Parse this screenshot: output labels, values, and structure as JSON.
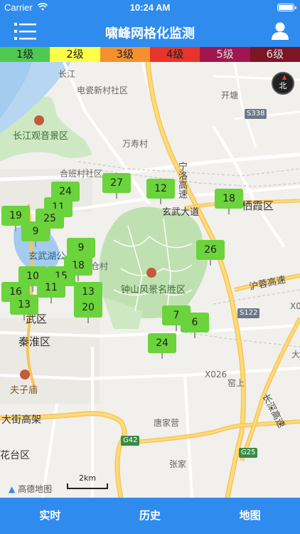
{
  "status_bar": {
    "carrier": "Carrier",
    "time": "10:24 AM"
  },
  "nav": {
    "title": "啸峰网格化监测"
  },
  "legend": [
    {
      "label": "1级",
      "color": "#4fc94f",
      "text_color": "#222222"
    },
    {
      "label": "2级",
      "color": "#ffff45",
      "text_color": "#222222"
    },
    {
      "label": "3级",
      "color": "#f5902f",
      "text_color": "#222222"
    },
    {
      "label": "4级",
      "color": "#e8342a",
      "text_color": "#222222"
    },
    {
      "label": "5级",
      "color": "#a0174f",
      "text_color": "#dddddd"
    },
    {
      "label": "6级",
      "color": "#7c1524",
      "text_color": "#dddddd"
    }
  ],
  "map": {
    "labels": {
      "changjiang": "长江",
      "dianzixincun": "电瓷新村社区",
      "kaitang": "开塘",
      "s338": "S338",
      "guanyin": "长江观音景区",
      "wanshoucun": "万寿村",
      "hecun": "合班村社区",
      "ningluo": "宁洛高速",
      "xuanwudadao": "玄武大道",
      "qixiaqu": "栖霞区",
      "xuanwuhu": "玄武湖公",
      "zhongshan": "钟山风景名胜区",
      "hurong": "沪蓉高速",
      "wuqu": "武区",
      "qinhuai": "秦淮区",
      "s122": "S122",
      "x0": "X0",
      "fuzimiao": "夫子庙",
      "x026": "X026",
      "yaoshang": "窑上",
      "changshen": "长深高速",
      "dajie": "大街高架",
      "tangjiaying": "唐家营",
      "g42": "G42",
      "g25": "G25",
      "taiqu": "花台区",
      "zhangjia": "张家",
      "da": "大",
      "cun": "仓村"
    },
    "markers": [
      "24",
      "27",
      "12",
      "18",
      "11",
      "19",
      "25",
      "9",
      "9",
      "26",
      "18",
      "10",
      "15",
      "11",
      "16",
      "13",
      "13",
      "20",
      "7",
      "6",
      "24"
    ],
    "logo": "高德地图",
    "scale": "2km",
    "compass": "北"
  },
  "tabs": [
    "实时",
    "历史",
    "地图"
  ]
}
